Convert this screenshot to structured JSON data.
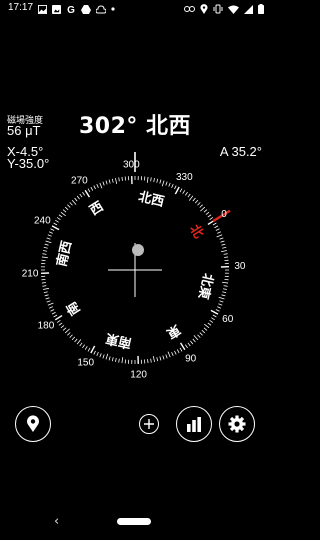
{
  "status_bar": {
    "time": "17:17",
    "left_icons": [
      "image-icon",
      "gallery-icon",
      "google-icon",
      "drive-icon",
      "cloud-icon",
      "dot-icon"
    ],
    "right_icons": [
      "link-icon",
      "location-icon",
      "vibrate-icon",
      "wifi-icon",
      "signal-icon",
      "battery-icon"
    ]
  },
  "readout": {
    "heading": "302° 北西",
    "field_label": "磁場強度",
    "field_value": "56 μT",
    "tilt_x": "X-4.5°",
    "tilt_y": "Y-35.0°",
    "accuracy": "A  35.2°"
  },
  "dial": {
    "rotation_deg": -302,
    "heading_deg": 302,
    "degree_labels": [
      "0",
      "30",
      "60",
      "90",
      "120",
      "150",
      "180",
      "210",
      "240",
      "270",
      "300",
      "330"
    ],
    "direction_labels": [
      "北",
      "北東",
      "東",
      "南東",
      "南",
      "南西",
      "西",
      "北西"
    ],
    "north_color": "#e0261e",
    "bubble": {
      "x_tilt_deg": -4.5,
      "y_tilt_deg": -35.0
    }
  },
  "toolbar": {
    "location_button": "location-pin-icon",
    "add_button": "plus-icon",
    "stats_button": "bar-chart-icon",
    "settings_button": "gear-icon"
  },
  "nav": {
    "back": "‹"
  }
}
